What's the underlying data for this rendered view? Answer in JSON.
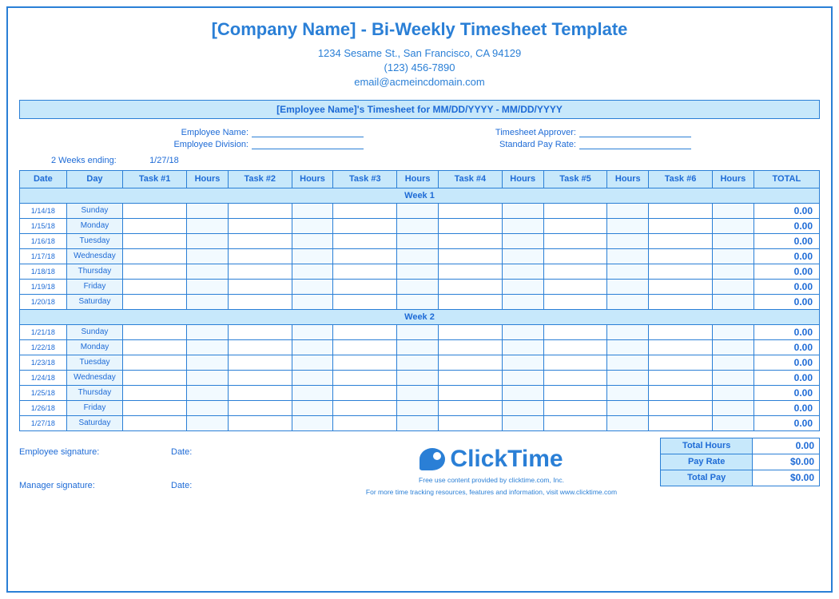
{
  "header": {
    "title": "[Company Name] - Bi-Weekly Timesheet Template",
    "address": "1234 Sesame St.,  San Francisco, CA 94129",
    "phone": "(123) 456-7890",
    "email": "email@acmeincdomain.com"
  },
  "banner": "[Employee Name]'s Timesheet for MM/DD/YYYY - MM/DD/YYYY",
  "meta": {
    "emp_name_label": "Employee Name:",
    "emp_div_label": "Employee Division:",
    "approver_label": "Timesheet Approver:",
    "payrate_label": "Standard Pay Rate:",
    "period_label": "2 Weeks ending:",
    "period_value": "1/27/18"
  },
  "columns": {
    "date": "Date",
    "day": "Day",
    "t1": "Task #1",
    "t2": "Task #2",
    "t3": "Task #3",
    "t4": "Task #4",
    "t5": "Task #5",
    "t6": "Task #6",
    "hours": "Hours",
    "total": "TOTAL"
  },
  "week1_label": "Week 1",
  "week2_label": "Week 2",
  "week1": [
    {
      "date": "1/14/18",
      "day": "Sunday",
      "total": "0.00"
    },
    {
      "date": "1/15/18",
      "day": "Monday",
      "total": "0.00"
    },
    {
      "date": "1/16/18",
      "day": "Tuesday",
      "total": "0.00"
    },
    {
      "date": "1/17/18",
      "day": "Wednesday",
      "total": "0.00"
    },
    {
      "date": "1/18/18",
      "day": "Thursday",
      "total": "0.00"
    },
    {
      "date": "1/19/18",
      "day": "Friday",
      "total": "0.00"
    },
    {
      "date": "1/20/18",
      "day": "Saturday",
      "total": "0.00"
    }
  ],
  "week2": [
    {
      "date": "1/21/18",
      "day": "Sunday",
      "total": "0.00"
    },
    {
      "date": "1/22/18",
      "day": "Monday",
      "total": "0.00"
    },
    {
      "date": "1/23/18",
      "day": "Tuesday",
      "total": "0.00"
    },
    {
      "date": "1/24/18",
      "day": "Wednesday",
      "total": "0.00"
    },
    {
      "date": "1/25/18",
      "day": "Thursday",
      "total": "0.00"
    },
    {
      "date": "1/26/18",
      "day": "Friday",
      "total": "0.00"
    },
    {
      "date": "1/27/18",
      "day": "Saturday",
      "total": "0.00"
    }
  ],
  "footer": {
    "emp_sig": "Employee signature:",
    "mgr_sig": "Manager signature:",
    "date_label": "Date:",
    "logo_text": "ClickTime",
    "fine1": "Free use content provided by clicktime.com, Inc.",
    "fine2": "For more time tracking resources, features and information, visit www.clicktime.com"
  },
  "summary": {
    "total_hours_label": "Total Hours",
    "total_hours": "0.00",
    "pay_rate_label": "Pay Rate",
    "pay_rate": "$0.00",
    "total_pay_label": "Total Pay",
    "total_pay": "$0.00"
  }
}
